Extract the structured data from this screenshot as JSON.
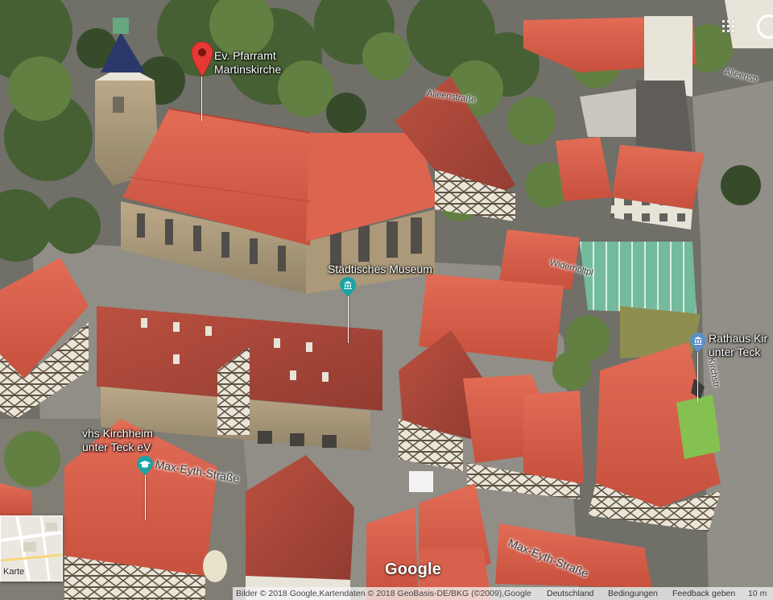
{
  "map": {
    "type": "satellite-3d",
    "pois": [
      {
        "id": "pfarramt",
        "name_line1": "Ev. Pfarramt",
        "name_line2": "Martinskirche",
        "icon": "red-pin-icon",
        "color": "#E53935"
      },
      {
        "id": "museum",
        "name_line1": "Städtisches Museum",
        "name_line2": "",
        "icon": "museum-icon",
        "color": "#1BA3A3"
      },
      {
        "id": "rathaus",
        "name_line1": "Rathaus Kir",
        "name_line2": "unter Teck",
        "icon": "government-icon",
        "color": "#5C8FC6"
      },
      {
        "id": "vhs",
        "name_line1": "vhs Kirchheim",
        "name_line2": "unter Teck eV",
        "icon": "school-icon",
        "color": "#1BA3A3"
      }
    ],
    "streets": {
      "alleenstr_1": "Alleenstraße",
      "alleenstr_2": "Alleenstr",
      "widerholtpl": "Widerholtpl",
      "max_eyth_1": "Max-Eyth-Straße",
      "max_eyth_2": "Max-Eyth-Straße",
      "kirchstr": "Kirchstr"
    }
  },
  "controls": {
    "minimap_label": "Karte",
    "google_logo": "Google",
    "apps_icon": "apps-grid-icon"
  },
  "attribution": {
    "imagery": "Bilder © 2018 Google,Kartendaten © 2018 GeoBasis-DE/BKG (©2009),Google",
    "country": "Deutschland",
    "terms": "Bedingungen",
    "feedback": "Feedback geben",
    "scale": "10 m"
  }
}
